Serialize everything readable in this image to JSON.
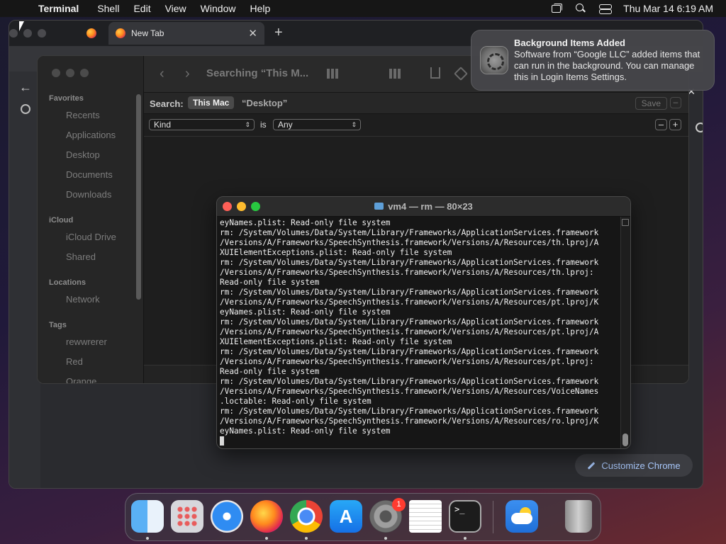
{
  "menubar": {
    "app": "Terminal",
    "items": [
      "Shell",
      "Edit",
      "View",
      "Window",
      "Help"
    ],
    "clock": "Thu Mar 14  6:19 AM"
  },
  "browser": {
    "active_tab": "New Tab",
    "close_symbol": "✕",
    "new_tab_symbol": "+",
    "back_symbol": "←",
    "customize_label": "Customize Chrome"
  },
  "finder": {
    "title": "Searching “This M...",
    "sidebar": {
      "favorites_header": "Favorites",
      "favorites": [
        "Recents",
        "Applications",
        "Desktop",
        "Documents",
        "Downloads"
      ],
      "icloud_header": "iCloud",
      "icloud": [
        "iCloud Drive",
        "Shared"
      ],
      "locations_header": "Locations",
      "locations": [
        "Network"
      ],
      "tags_header": "Tags",
      "tags": [
        "rewwrerer",
        "Red",
        "Orange"
      ]
    },
    "search": {
      "label": "Search:",
      "scope_active": "This Mac",
      "scope_other": "“Desktop”",
      "save_label": "Save",
      "minus": "–"
    },
    "criteria": {
      "attribute": "Kind",
      "operator": "is",
      "value": "Any",
      "remove": "–",
      "add": "+"
    }
  },
  "notification": {
    "title": "Background Items Added",
    "body": "Software from “Google LLC” added items that can run in the background. You can manage this in Login Items Settings."
  },
  "terminal": {
    "title": "vm4 — rm — 80×23",
    "lines": [
      "eyNames.plist: Read-only file system",
      "rm: /System/Volumes/Data/System/Library/Frameworks/ApplicationServices.framework",
      "/Versions/A/Frameworks/SpeechSynthesis.framework/Versions/A/Resources/th.lproj/A",
      "XUIElementExceptions.plist: Read-only file system",
      "rm: /System/Volumes/Data/System/Library/Frameworks/ApplicationServices.framework",
      "/Versions/A/Frameworks/SpeechSynthesis.framework/Versions/A/Resources/th.lproj:",
      "Read-only file system",
      "rm: /System/Volumes/Data/System/Library/Frameworks/ApplicationServices.framework",
      "/Versions/A/Frameworks/SpeechSynthesis.framework/Versions/A/Resources/pt.lproj/K",
      "eyNames.plist: Read-only file system",
      "rm: /System/Volumes/Data/System/Library/Frameworks/ApplicationServices.framework",
      "/Versions/A/Frameworks/SpeechSynthesis.framework/Versions/A/Resources/pt.lproj/A",
      "XUIElementExceptions.plist: Read-only file system",
      "rm: /System/Volumes/Data/System/Library/Frameworks/ApplicationServices.framework",
      "/Versions/A/Frameworks/SpeechSynthesis.framework/Versions/A/Resources/pt.lproj:",
      "Read-only file system",
      "rm: /System/Volumes/Data/System/Library/Frameworks/ApplicationServices.framework",
      "/Versions/A/Frameworks/SpeechSynthesis.framework/Versions/A/Resources/VoiceNames",
      ".loctable: Read-only file system",
      "rm: /System/Volumes/Data/System/Library/Frameworks/ApplicationServices.framework",
      "/Versions/A/Frameworks/SpeechSynthesis.framework/Versions/A/Resources/ro.lproj/K",
      "eyNames.plist: Read-only file system"
    ]
  },
  "dock": {
    "settings_badge": "1",
    "apps": [
      "finder-icon",
      "launchpad-icon",
      "safari-icon",
      "firefox-icon",
      "chrome-icon",
      "app-store-icon",
      "system-settings-icon",
      "textedit-icon",
      "terminal-icon",
      "weather-icon",
      "trash-icon"
    ]
  },
  "colors": {
    "close": "#ff5f57",
    "minimize": "#febc2e",
    "zoom": "#28c840",
    "chrome_accent": "#a8c7fa",
    "badge": "#ff3b30"
  }
}
